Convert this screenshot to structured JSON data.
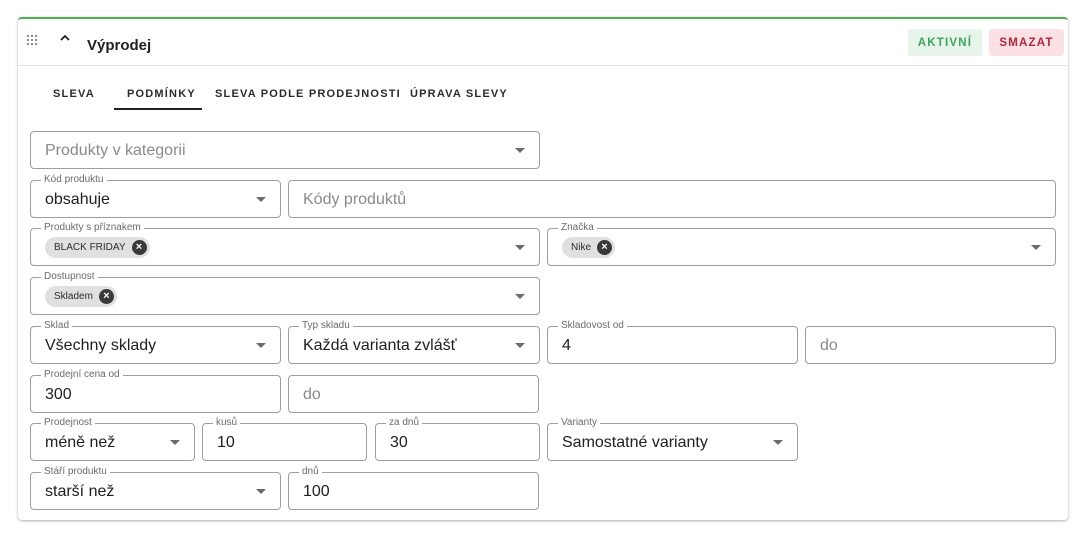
{
  "header": {
    "title": "Výprodej",
    "active_label": "AKTIVNÍ",
    "delete_label": "SMAZAT"
  },
  "tabs": [
    {
      "label": "SLEVA"
    },
    {
      "label": "PODMÍNKY"
    },
    {
      "label": "SLEVA PODLE PRODEJNOSTI"
    },
    {
      "label": "ÚPRAVA SLEVY"
    }
  ],
  "form": {
    "category": {
      "placeholder": "Produkty v kategorii"
    },
    "product_code": {
      "legend": "Kód produktu",
      "value": "obsahuje"
    },
    "product_codes": {
      "placeholder": "Kódy produktů"
    },
    "flags": {
      "legend": "Produkty s příznakem",
      "chip": "BLACK FRIDAY"
    },
    "brand": {
      "legend": "Značka",
      "chip": "Nike"
    },
    "availability": {
      "legend": "Dostupnost",
      "chip": "Skladem"
    },
    "warehouse": {
      "legend": "Sklad",
      "value": "Všechny sklady"
    },
    "warehouse_type": {
      "legend": "Typ skladu",
      "value": "Každá varianta zvlášť"
    },
    "stock_from": {
      "legend": "Skladovost od",
      "value": "4"
    },
    "stock_to": {
      "placeholder": "do"
    },
    "price_from": {
      "legend": "Prodejní cena od",
      "value": "300"
    },
    "price_to": {
      "placeholder": "do"
    },
    "sales": {
      "legend": "Prodejnost",
      "value": "méně než"
    },
    "pieces": {
      "legend": "kusů",
      "value": "10"
    },
    "days_window": {
      "legend": "za dnů",
      "value": "30"
    },
    "variants": {
      "legend": "Varianty",
      "value": "Samostatné varianty"
    },
    "age": {
      "legend": "Stáří produktu",
      "value": "starší než"
    },
    "age_days": {
      "legend": "dnů",
      "value": "100"
    }
  },
  "icons": {
    "drag": "drag-handle-icon",
    "collapse": "chevron-up-icon",
    "dropdown": "dropdown-arrow-icon",
    "chip_remove": "remove-chip-icon"
  },
  "colors": {
    "accent_border": "#4caf50",
    "active_bg": "#e6f4ea",
    "active_text": "#3fa45b",
    "delete_bg": "#fbe1e4",
    "delete_text": "#b0283b"
  }
}
